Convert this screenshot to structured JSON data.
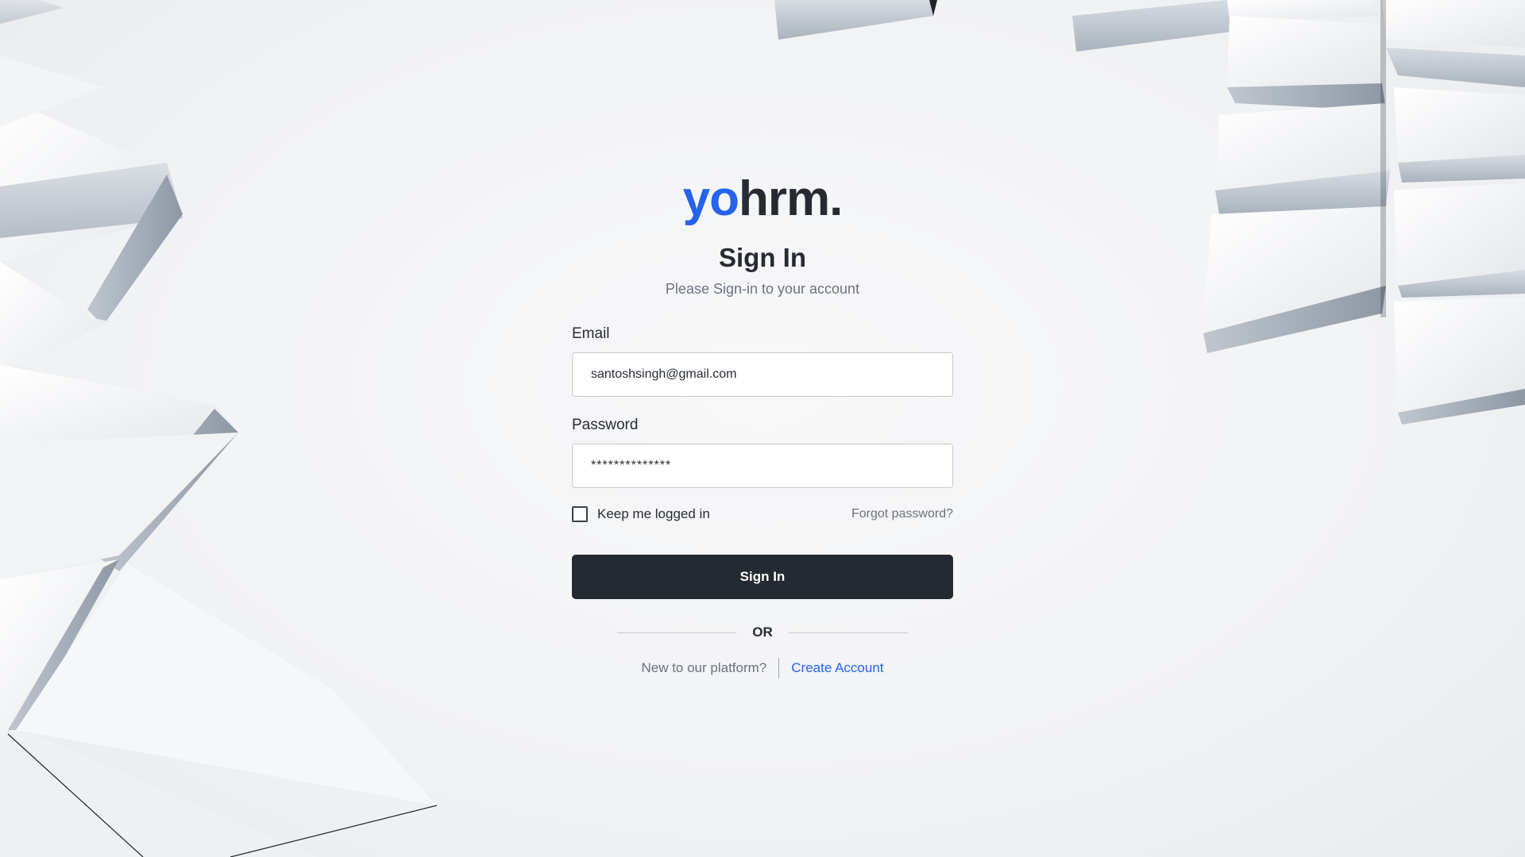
{
  "brand": {
    "logo_prefix": "yo",
    "logo_suffix": "hrm.",
    "prefix_color": "#2563eb",
    "suffix_color": "#262b33"
  },
  "header": {
    "title": "Sign In",
    "subtitle": "Please Sign-in to your account"
  },
  "form": {
    "email_label": "Email",
    "email_value": "santoshsingh@gmail.com",
    "password_label": "Password",
    "password_value": "**************",
    "keep_logged_in_label": "Keep me logged in",
    "keep_logged_in_checked": false,
    "forgot_password_label": "Forgot password?",
    "submit_label": "Sign In"
  },
  "divider": {
    "label": "OR"
  },
  "register": {
    "prompt": "New to our platform?",
    "link_label": "Create Account",
    "link_color": "#2563eb"
  },
  "theme": {
    "button_bg": "#242a31",
    "text_primary": "#262b33",
    "text_muted": "#6b7280"
  }
}
